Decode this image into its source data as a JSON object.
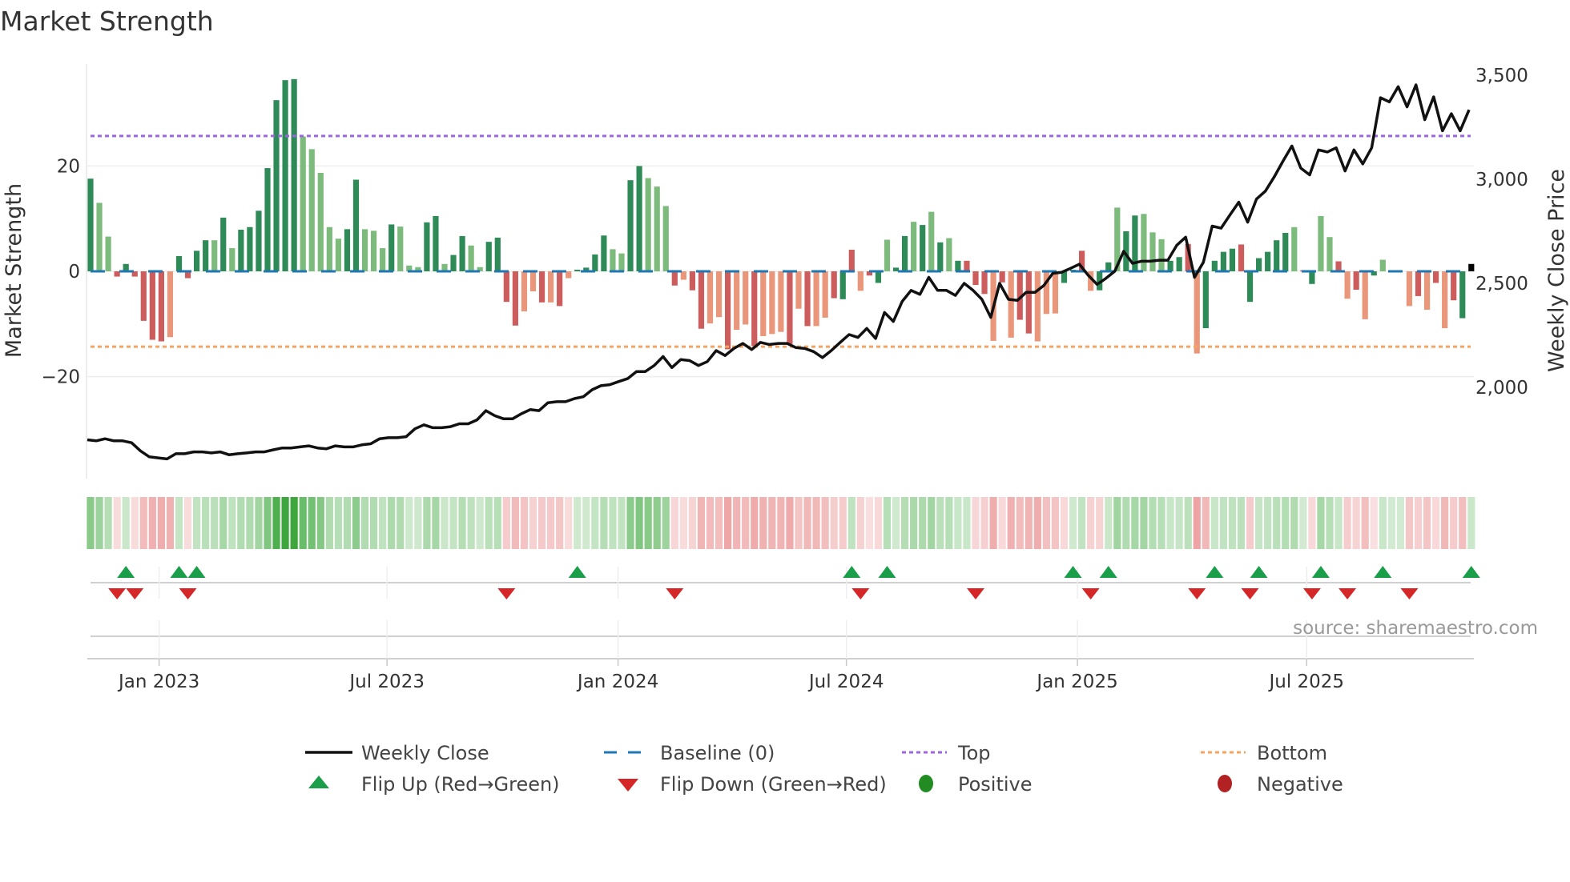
{
  "title": "Market Strength",
  "source": "source: sharemaestro.com",
  "colors": {
    "pos_strong": "#2e8b57",
    "pos_weak": "#7dbb7d",
    "neg_strong": "#cd5c5c",
    "neg_weak": "#e9967a",
    "baseline": "#1f77b4",
    "top": "#9b66e0",
    "bottom": "#f4a460",
    "close": "#111111",
    "flip_up": "#1a9e4a",
    "flip_down": "#d62728",
    "positive": "#228b22",
    "negative": "#b22222"
  },
  "legend": {
    "weekly_close": "Weekly Close",
    "baseline": "Baseline (0)",
    "top": "Top",
    "bottom": "Bottom",
    "flip_up": "Flip Up (Red→Green)",
    "flip_down": "Flip Down (Green→Red)",
    "positive": "Positive",
    "negative": "Negative"
  },
  "chart_data": {
    "type": "bar",
    "title": "Market Strength",
    "ylabel": "Market Strength",
    "y2label": "Weekly Close Price",
    "ylim": [
      -39,
      39
    ],
    "y2lim": [
      1450,
      3650
    ],
    "yticks": [
      {
        "value": 20,
        "label": "20"
      },
      {
        "value": 0,
        "label": "0"
      },
      {
        "value": -20,
        "label": "−20"
      }
    ],
    "y2ticks": [
      {
        "value": 3500,
        "label": "3,500"
      },
      {
        "value": 3000,
        "label": "3,000"
      },
      {
        "value": 2500,
        "label": "2,500"
      },
      {
        "value": 2000,
        "label": "2,000"
      }
    ],
    "xticks": [
      {
        "week": 8.75,
        "label": "Jan 2023"
      },
      {
        "week": 34.5,
        "label": "Jul 2023"
      },
      {
        "week": 60.6,
        "label": "Jan 2024"
      },
      {
        "week": 86.4,
        "label": "Jul 2024"
      },
      {
        "week": 112.5,
        "label": "Jan 2025"
      },
      {
        "week": 138.4,
        "label": "Jul 2025"
      }
    ],
    "top_level": 25.7,
    "bottom_level": -14.3,
    "baseline": 0,
    "strength": [
      17.6,
      13.0,
      6.6,
      -1.0,
      1.4,
      -1.0,
      -9.4,
      -13.0,
      -13.3,
      -12.5,
      2.9,
      -1.3,
      3.9,
      5.9,
      5.9,
      10.2,
      4.4,
      7.9,
      8.4,
      11.5,
      19.6,
      32.5,
      36.3,
      36.5,
      25.6,
      23.2,
      18.7,
      8.4,
      6.2,
      8.0,
      17.4,
      8.0,
      7.7,
      4.4,
      8.9,
      8.5,
      1.1,
      0.8,
      9.3,
      10.5,
      1.4,
      3.1,
      6.7,
      4.9,
      0.8,
      5.6,
      6.4,
      -5.8,
      -10.3,
      -7.6,
      -3.8,
      -5.9,
      -5.9,
      -6.6,
      -1.3,
      0.3,
      0.7,
      3.2,
      6.8,
      4.2,
      3.4,
      17.3,
      20.0,
      17.7,
      16.1,
      12.4,
      -2.7,
      -1.6,
      -3.6,
      -10.9,
      -9.9,
      -8.7,
      -14.8,
      -11.1,
      -10.1,
      -14.2,
      -12.3,
      -11.9,
      -11.5,
      -13.8,
      -7.1,
      -10.4,
      -10.4,
      -8.8,
      -5.1,
      -5.3,
      4.1,
      -3.7,
      -0.8,
      -2.2,
      6.0,
      0.7,
      6.7,
      9.4,
      8.8,
      11.3,
      5.5,
      6.3,
      2.0,
      2.0,
      -2.6,
      -4.3,
      -13.2,
      -2.1,
      -12.6,
      -9.2,
      -11.8,
      -13.3,
      -8.1,
      -8.0,
      -2.2,
      0.3,
      3.9,
      -3.7,
      -3.6,
      1.7,
      12.1,
      7.6,
      10.6,
      10.9,
      7.4,
      6.1,
      2.0,
      2.7,
      5.2,
      -15.6,
      -10.8,
      2.0,
      3.7,
      4.3,
      5.1,
      -5.8,
      2.5,
      3.7,
      5.9,
      7.3,
      8.4,
      0.2,
      -2.4,
      10.5,
      6.5,
      1.9,
      -5.2,
      -3.5,
      -9.1,
      -0.8,
      2.2,
      0,
      0,
      -6.6,
      -4.7,
      -7.3,
      -2.2,
      -10.8,
      -5.5,
      -8.9,
      1.4
    ],
    "shade": "DLLRDRRRRSDRDDLDLDDDDDDDLLLLLDDLLLDLLLDDLDDLLDDRRSSRSRSDDDDLLDDLLLRSRRSSRSSRSSSRSRSSRDRSRDLDDLDLDLDRRRSRSRRSSSDDRSDDLDDLLLDDRSDDDDRDDDDDLRDLLRSRSDLLRSRSRSRD",
    "weekly_close": [
      1748,
      1743,
      1753,
      1743,
      1743,
      1734,
      1695,
      1666,
      1661,
      1656,
      1681,
      1681,
      1690,
      1690,
      1685,
      1690,
      1676,
      1681,
      1685,
      1690,
      1690,
      1700,
      1709,
      1709,
      1714,
      1719,
      1709,
      1705,
      1719,
      1714,
      1714,
      1724,
      1729,
      1753,
      1758,
      1758,
      1763,
      1801,
      1820,
      1806,
      1806,
      1811,
      1825,
      1825,
      1844,
      1888,
      1864,
      1849,
      1849,
      1873,
      1893,
      1888,
      1926,
      1931,
      1931,
      1946,
      1955,
      1989,
      2008,
      2013,
      2028,
      2042,
      2076,
      2076,
      2105,
      2148,
      2095,
      2134,
      2129,
      2105,
      2124,
      2177,
      2153,
      2187,
      2211,
      2182,
      2216,
      2206,
      2211,
      2211,
      2191,
      2187,
      2172,
      2143,
      2177,
      2216,
      2254,
      2240,
      2283,
      2235,
      2360,
      2317,
      2413,
      2466,
      2447,
      2529,
      2466,
      2466,
      2442,
      2500,
      2466,
      2423,
      2336,
      2500,
      2423,
      2418,
      2457,
      2457,
      2490,
      2548,
      2553,
      2572,
      2592,
      2539,
      2495,
      2524,
      2558,
      2654,
      2596,
      2606,
      2606,
      2611,
      2611,
      2683,
      2722,
      2529,
      2601,
      2775,
      2765,
      2828,
      2890,
      2794,
      2905,
      2943,
      3011,
      3088,
      3160,
      3054,
      3021,
      3141,
      3131,
      3151,
      3040,
      3141,
      3074,
      3151,
      3392,
      3372,
      3445,
      3348,
      3454,
      3286,
      3396,
      3233,
      3315,
      3233,
      3334
    ],
    "flip_up_weeks": [
      5,
      11,
      13,
      56,
      87,
      91,
      112,
      116,
      128,
      133,
      140,
      147,
      157
    ],
    "flip_down_weeks": [
      4,
      6,
      12,
      48,
      67,
      88,
      101,
      114,
      126,
      132,
      139,
      143,
      150
    ]
  }
}
